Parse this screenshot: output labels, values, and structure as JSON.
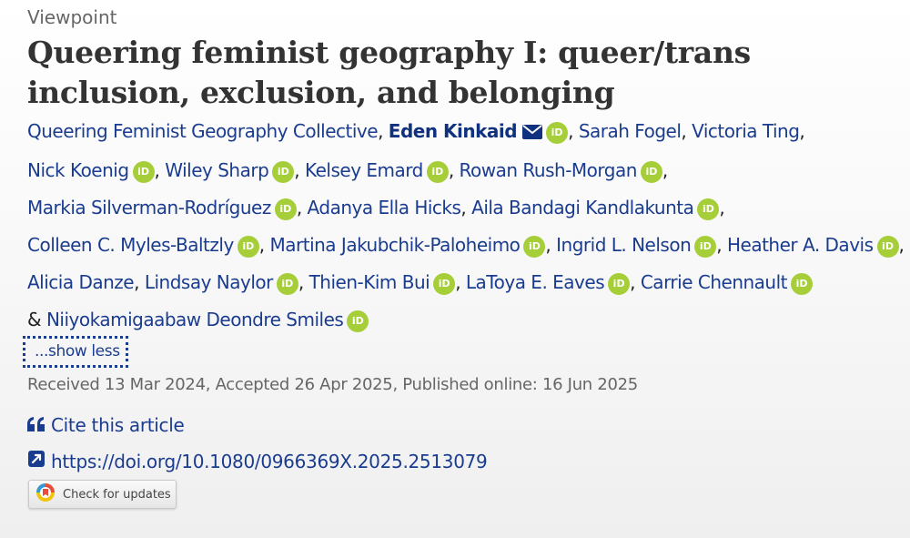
{
  "article_type": "Viewpoint",
  "title": "Queering feminist geography I: queer/trans inclusion, exclusion, and belonging",
  "authors": [
    {
      "name": "Queering Feminist Geography Collective",
      "orcid": false,
      "corresponding": false
    },
    {
      "name": "Eden Kinkaid",
      "orcid": true,
      "corresponding": true
    },
    {
      "name": "Sarah Fogel",
      "orcid": false,
      "corresponding": false
    },
    {
      "name": "Victoria Ting",
      "orcid": false,
      "corresponding": false
    },
    {
      "name": "Nick Koenig",
      "orcid": true,
      "corresponding": false
    },
    {
      "name": "Wiley Sharp",
      "orcid": true,
      "corresponding": false
    },
    {
      "name": "Kelsey Emard",
      "orcid": true,
      "corresponding": false
    },
    {
      "name": "Rowan Rush-Morgan",
      "orcid": true,
      "corresponding": false
    },
    {
      "name": "Markia Silverman-Rodríguez",
      "orcid": true,
      "corresponding": false
    },
    {
      "name": "Adanya Ella Hicks",
      "orcid": false,
      "corresponding": false
    },
    {
      "name": "Aila Bandagi Kandlakunta",
      "orcid": true,
      "corresponding": false
    },
    {
      "name": "Colleen C. Myles-Baltzly",
      "orcid": true,
      "corresponding": false
    },
    {
      "name": "Martina Jakubchik-Paloheimo",
      "orcid": true,
      "corresponding": false
    },
    {
      "name": "Ingrid L. Nelson",
      "orcid": true,
      "corresponding": false
    },
    {
      "name": "Heather A. Davis",
      "orcid": true,
      "corresponding": false
    },
    {
      "name": "Alicia Danze",
      "orcid": false,
      "corresponding": false
    },
    {
      "name": "Lindsay Naylor",
      "orcid": true,
      "corresponding": false
    },
    {
      "name": "Thien-Kim Bui",
      "orcid": true,
      "corresponding": false
    },
    {
      "name": "LaToya E. Eaves",
      "orcid": true,
      "corresponding": false
    },
    {
      "name": "Carrie Chennault",
      "orcid": true,
      "corresponding": false
    },
    {
      "name": "Niiyokamigaabaw Deondre Smiles",
      "orcid": true,
      "corresponding": false
    }
  ],
  "orcid_label": "iD",
  "ampersand": "&",
  "separator": ",",
  "show_less_label": "...show less",
  "dates": "Received 13 Mar 2024, Accepted 26 Apr 2025, Published online: 16 Jun 2025",
  "cite_label": "Cite this article",
  "doi_link": "https://doi.org/10.1080/0966369X.2025.2513079",
  "updates_button_label": "Check for updates",
  "colors": {
    "link": "#1a3c8f",
    "orcid": "#a6ce39",
    "muted": "#666666"
  }
}
